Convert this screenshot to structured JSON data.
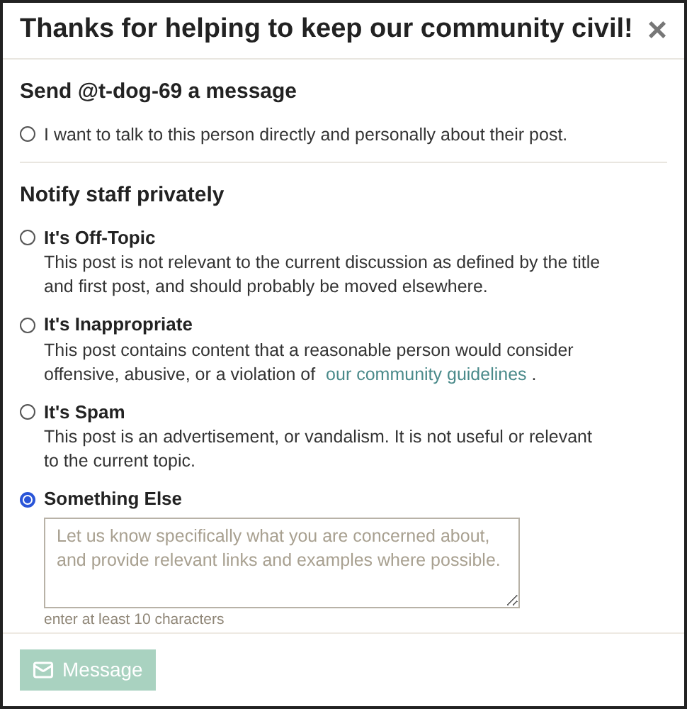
{
  "dialog": {
    "title": "Thanks for helping to keep our community civil!",
    "close": "×"
  },
  "message_section": {
    "heading": "Send @t-dog-69 a message",
    "option": {
      "label": "I want to talk to this person directly and personally about their post.",
      "selected": false
    }
  },
  "staff_section": {
    "heading": "Notify staff privately",
    "options": [
      {
        "label": "It's Off-Topic",
        "description": "This post is not relevant to the current discussion as defined by the title and first post, and should probably be moved elsewhere.",
        "selected": false
      },
      {
        "label": "It's Inappropriate",
        "description": "This post contains content that a reasonable person would consider offensive, abusive, or a violation of",
        "link": "our community guidelines",
        "description_end": ".",
        "selected": false
      },
      {
        "label": "It's Spam",
        "description": "This post is an advertisement, or vandalism. It is not useful or relevant to the current topic.",
        "selected": false
      },
      {
        "label": "Something Else",
        "selected": true,
        "textarea": {
          "placeholder": "Let us know specifically what you are concerned about, and provide relevant links and examples where possible."
        },
        "hint": "enter at least 10 characters"
      }
    ]
  },
  "footer": {
    "button": {
      "label": "Message",
      "disabled": true
    }
  }
}
